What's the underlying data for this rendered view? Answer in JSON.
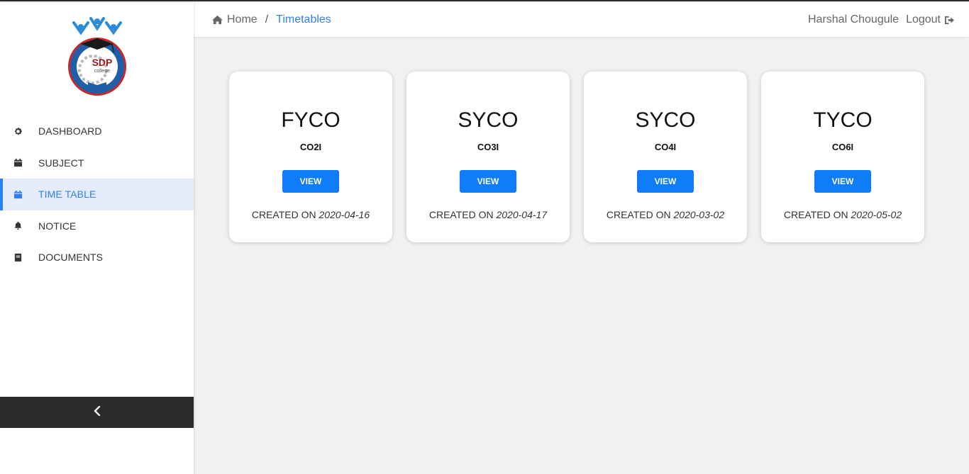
{
  "logo": {
    "text": "SDP",
    "subtext": "college",
    "ring_text": "SHREE DATTA POLYTECHNIC COLLEGE"
  },
  "sidebar": {
    "items": [
      {
        "label": "DASHBOARD",
        "icon": "gear-icon"
      },
      {
        "label": "SUBJECT",
        "icon": "calendar-icon"
      },
      {
        "label": "TIME TABLE",
        "icon": "calendar-icon",
        "active": true
      },
      {
        "label": "NOTICE",
        "icon": "bell-icon"
      },
      {
        "label": "DOCUMENTS",
        "icon": "book-icon"
      }
    ]
  },
  "breadcrumb": {
    "home": "Home",
    "separator": "/",
    "current": "Timetables"
  },
  "user": {
    "name": "Harshal Chougule",
    "logout": "Logout"
  },
  "cards": [
    {
      "title": "FYCO",
      "code": "CO2I",
      "button": "VIEW",
      "created_label": "CREATED ON",
      "created_date": "2020-04-16"
    },
    {
      "title": "SYCO",
      "code": "CO3I",
      "button": "VIEW",
      "created_label": "CREATED ON",
      "created_date": "2020-04-17"
    },
    {
      "title": "SYCO",
      "code": "CO4I",
      "button": "VIEW",
      "created_label": "CREATED ON",
      "created_date": "2020-03-02"
    },
    {
      "title": "TYCO",
      "code": "CO6I",
      "button": "VIEW",
      "created_label": "CREATED ON",
      "created_date": "2020-05-02"
    }
  ],
  "colors": {
    "accent": "#2d7ff9",
    "button": "#0f7cfa",
    "collapse_bar": "#2b2b2b",
    "active_bg": "#e3ecf8"
  }
}
